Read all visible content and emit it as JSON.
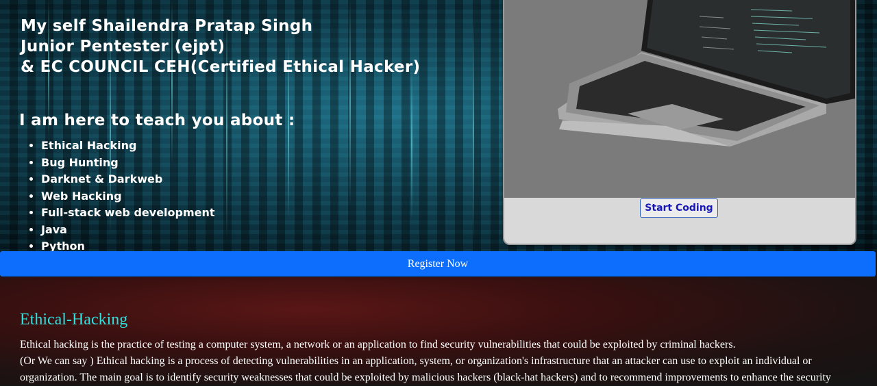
{
  "hero": {
    "intro_lines": [
      "My self Shailendra Pratap Singh",
      "Junior Pentester (ejpt)",
      "& EC COUNCIL CEH(Certified Ethical Hacker)"
    ],
    "teach_title": "I am here to teach you about :",
    "topics": [
      "Ethical Hacking",
      "Bug Hunting",
      "Darknet & Darkweb",
      "Web Hacking",
      "Full-stack web development",
      "Java",
      "Python"
    ]
  },
  "card": {
    "image_icon": "laptop-image",
    "button_label": "Start Coding"
  },
  "register": {
    "label": "Register Now",
    "color": "#0d6efd"
  },
  "section": {
    "title": "Ethical-Hacking",
    "title_color": "#2fe0df",
    "para1": "Ethical hacking is the practice of testing a computer system, a network or an application to find security vulnerabilities that could be exploited by criminal hackers.",
    "para2": "(Or We can say ) Ethical hacking is a process of detecting vulnerabilities in an application, system, or organization's infrastructure that an attacker can use to exploit an individual or organization. The main goal is to identify security weaknesses that could be exploited by malicious hackers (black-hat hackers) and to recommend improvements to enhance the security"
  }
}
